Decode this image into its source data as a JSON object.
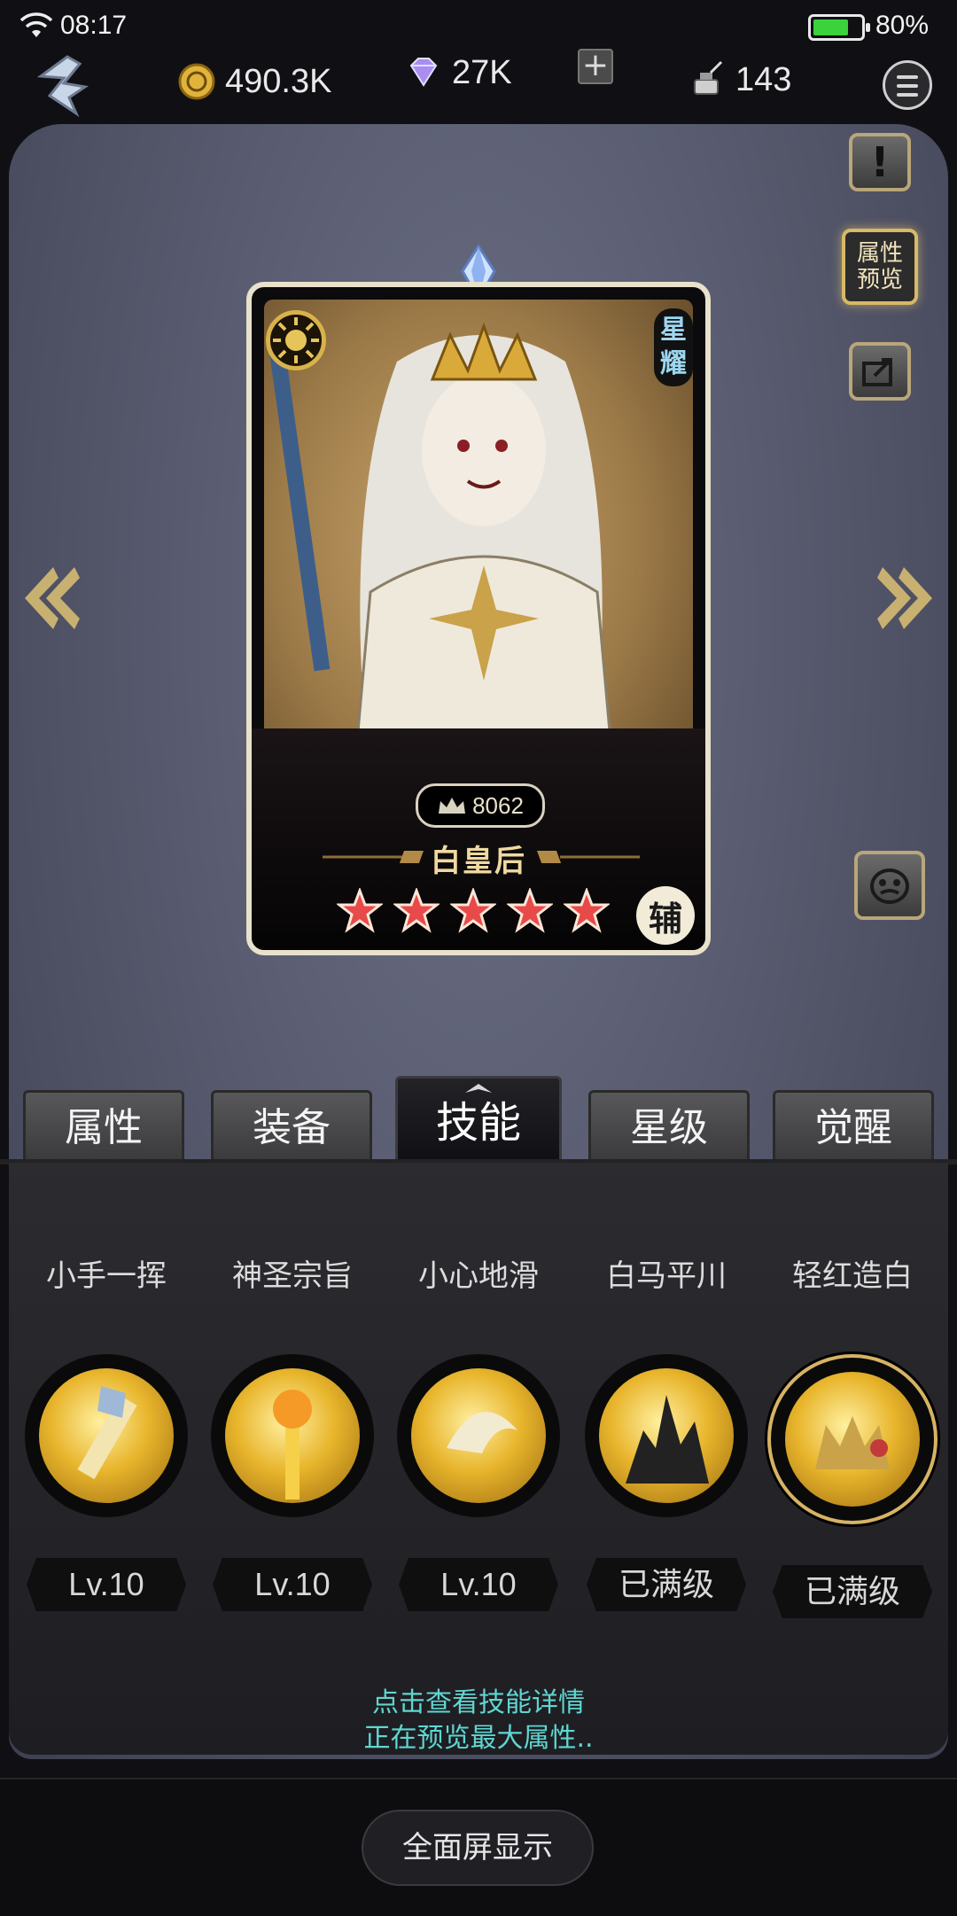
{
  "status_bar": {
    "time": "08:17",
    "battery": "80%",
    "battery_level": 0.8
  },
  "resources": {
    "gold": "490.3K",
    "diamonds": "27K",
    "ink": "143"
  },
  "side_buttons": {
    "preview_line1": "属性",
    "preview_line2": "预览"
  },
  "hero": {
    "name": "白皇后",
    "power": "8062",
    "stars": 5,
    "role": "辅",
    "rank_line1": "星",
    "rank_line2": "耀"
  },
  "tabs": [
    {
      "label": "属性"
    },
    {
      "label": "装备"
    },
    {
      "label": "技能"
    },
    {
      "label": "星级"
    },
    {
      "label": "觉醒"
    }
  ],
  "active_tab": 2,
  "skills": [
    {
      "name": "小手一挥",
      "level": "Lv.10"
    },
    {
      "name": "神圣宗旨",
      "level": "Lv.10"
    },
    {
      "name": "小心地滑",
      "level": "Lv.10"
    },
    {
      "name": "白马平川",
      "level": "已满级"
    },
    {
      "name": "轻红造白",
      "level": "已满级"
    }
  ],
  "hint": {
    "line1": "点击查看技能详情",
    "line2": "正在预览最大属性.."
  },
  "bottom": {
    "fullscreen_label": "全面屏显示"
  },
  "colors": {
    "accent_gold": "#d8b968",
    "hint_cyan": "#5fd6d1",
    "star_red": "#e84a4a"
  }
}
